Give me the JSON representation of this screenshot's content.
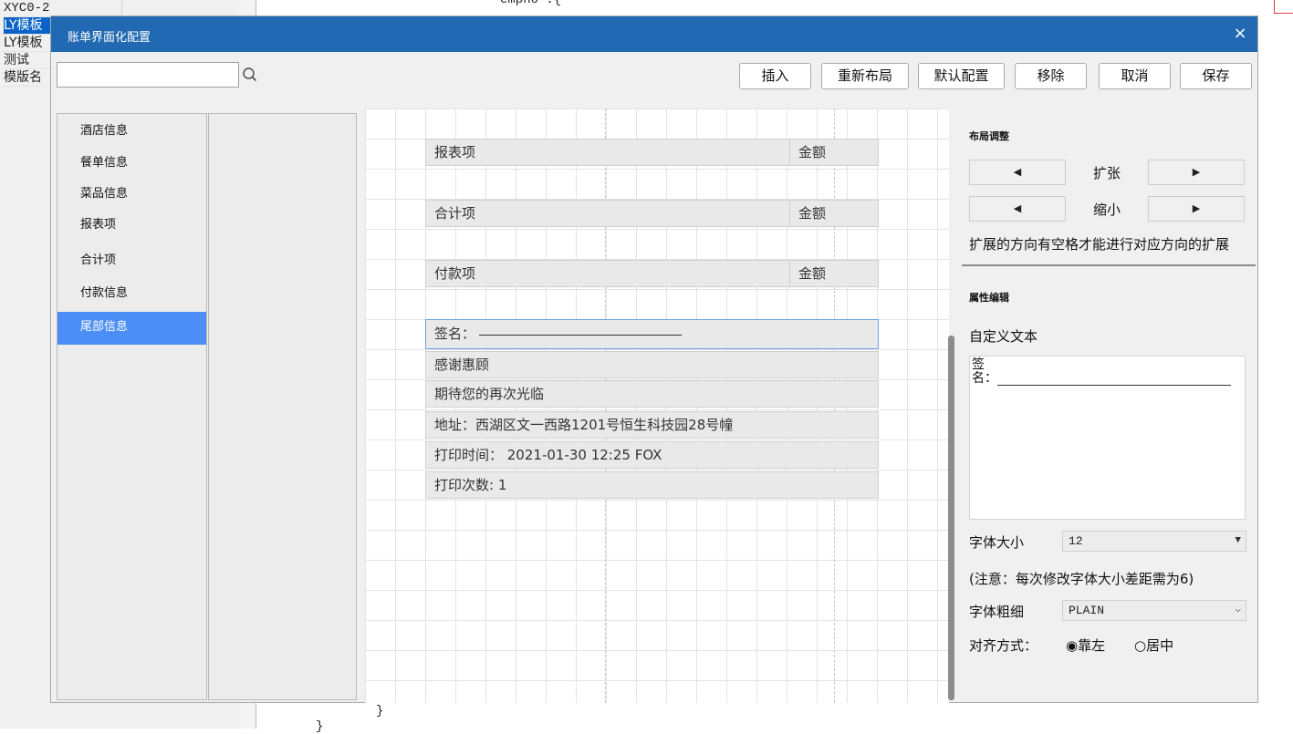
{
  "background": {
    "rows": [
      {
        "c1": "XYC0-2"
      },
      {
        "c1": "LY模板",
        "selected": true
      },
      {
        "c1": "LY模板"
      },
      {
        "c1": "测试"
      },
      {
        "c1": "模版名"
      }
    ],
    "code_top": "empno :{",
    "code_bottom": "}",
    "code_bottom2": "}"
  },
  "dialog": {
    "title": "账单界面化配置",
    "close_icon": "×",
    "search_placeholder": "",
    "search_value": ""
  },
  "toolbar": {
    "insert": "插入",
    "relayout": "重新布局",
    "default_config": "默认配置",
    "remove": "移除",
    "cancel": "取消",
    "save": "保存"
  },
  "categories": [
    {
      "label": "酒店信息"
    },
    {
      "label": "餐单信息"
    },
    {
      "label": "菜品信息"
    },
    {
      "label": "报表项"
    },
    {
      "label": "合计项"
    },
    {
      "label": "付款信息"
    },
    {
      "label": "尾部信息",
      "active": true
    }
  ],
  "canvas": {
    "report_item": {
      "label": "报表项",
      "amount": "金额"
    },
    "total_item": {
      "label": "合计项",
      "amount": "金额"
    },
    "payment_item": {
      "label": "付款项",
      "amount": "金额"
    },
    "signature": "签名：",
    "thanks": "感谢惠顾",
    "welcome": "期待您的再次光临",
    "address": "地址：西湖区文一西路1201号恒生科技园28号幢",
    "print_time": "打印时间： 2021-01-30 12:25   FOX",
    "print_count": "打印次数: 1"
  },
  "layout_panel": {
    "title": "布局调整",
    "expand_label": "扩张",
    "shrink_label": "缩小",
    "left_arrow": "◀",
    "right_arrow": "▶",
    "hint": "扩展的方向有空格才能进行对应方向的扩展"
  },
  "property_panel": {
    "title": "属性编辑",
    "custom_text_label": "自定义文本",
    "custom_text_line1": "签",
    "custom_text_line2": "名：",
    "font_size_label": "字体大小",
    "font_size_value": "12",
    "font_size_note": "(注意：每次修改字体大小差距需为6)",
    "font_weight_label": "字体粗细",
    "font_weight_value": "PLAIN",
    "align_label": "对齐方式：",
    "align_left": "◉靠左",
    "align_center": "○居中"
  }
}
